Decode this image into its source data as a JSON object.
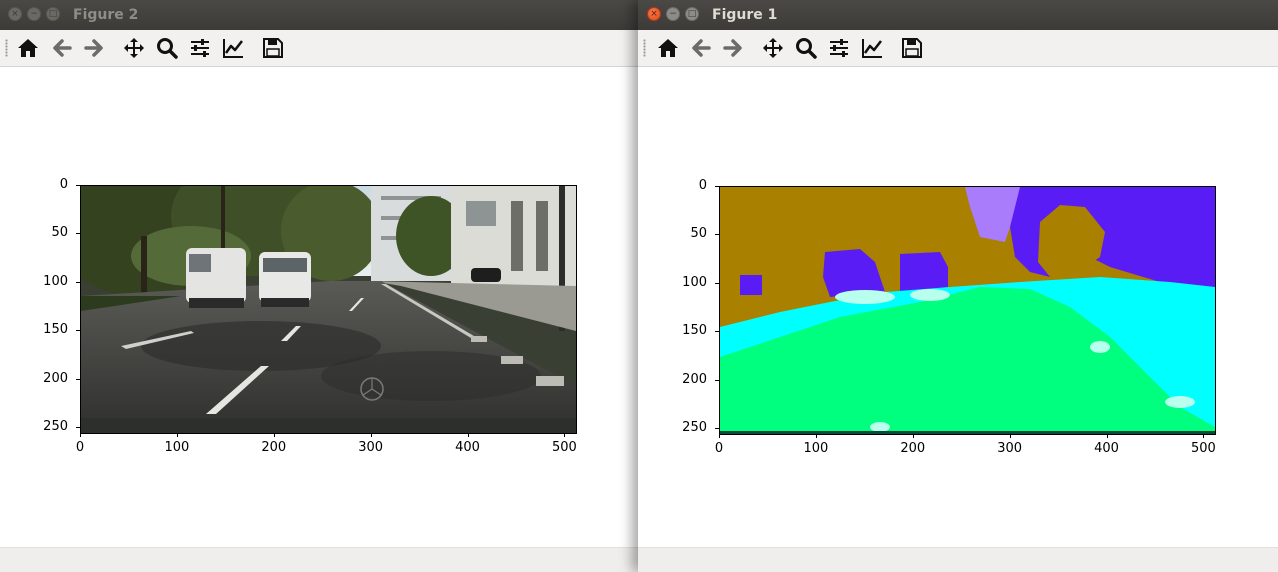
{
  "windows": {
    "figure2": {
      "title": "Figure 2",
      "state": "inactive",
      "axes": {
        "y_ticks": [
          "0",
          "50",
          "100",
          "150",
          "200",
          "250"
        ],
        "x_ticks": [
          "0",
          "100",
          "200",
          "300",
          "400",
          "500"
        ]
      },
      "image_description": "street scene photo"
    },
    "figure1": {
      "title": "Figure 1",
      "state": "active",
      "axes": {
        "y_ticks": [
          "0",
          "50",
          "100",
          "150",
          "200",
          "250"
        ],
        "x_ticks": [
          "0",
          "100",
          "200",
          "300",
          "400",
          "500"
        ]
      },
      "segmentation_colors": {
        "background": "#a98000",
        "vehicle": "#5a1cf5",
        "sidewalk": "#00ffff",
        "road": "#00ff7f",
        "sky": "#a87cfa",
        "highlight": "#b8ffee"
      }
    }
  },
  "toolbar_icons": [
    "home-icon",
    "back-arrow-icon",
    "forward-arrow-icon",
    "pan-icon",
    "zoom-icon",
    "configure-subplots-icon",
    "edit-axis-icon",
    "save-icon"
  ],
  "window_controls": {
    "close": "×",
    "minimize": "−",
    "maximize": "□"
  }
}
